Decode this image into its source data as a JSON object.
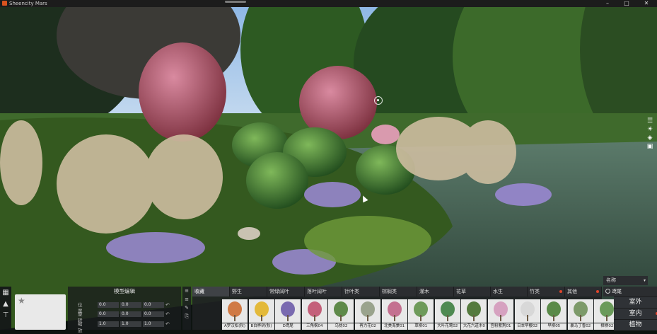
{
  "window": {
    "title": "Sheencity Mars",
    "minimize": "–",
    "maximize": "□",
    "close": "✕"
  },
  "right_toolbar": [
    {
      "icon": "list-icon",
      "glyph": "☰"
    },
    {
      "icon": "sun-icon",
      "glyph": "☀"
    },
    {
      "icon": "layers-icon",
      "glyph": "◈"
    },
    {
      "icon": "camera-icon",
      "glyph": "▣"
    }
  ],
  "left_tools": [
    {
      "icon": "object-icon",
      "glyph": "▦"
    },
    {
      "icon": "drop-icon",
      "glyph": "▲"
    },
    {
      "icon": "ruler-icon",
      "glyph": "⊤"
    }
  ],
  "model_panel": {
    "title": "模型编辑",
    "rows": [
      {
        "label": "位置",
        "values": [
          "0.0",
          "0.0",
          "0.0"
        ]
      },
      {
        "label": "旋转",
        "values": [
          "0.0",
          "0.0",
          "0.0"
        ]
      },
      {
        "label": "缩放",
        "values": [
          "1.0",
          "1.0",
          "1.0"
        ]
      }
    ],
    "reset_glyph": "↶"
  },
  "side_tools": [
    "≡",
    "≡",
    "✎",
    "⎘"
  ],
  "tabs": [
    {
      "label": "收藏",
      "active": true
    },
    {
      "label": "野生"
    },
    {
      "label": "常绿阔叶"
    },
    {
      "label": "落叶阔叶"
    },
    {
      "label": "针叶类"
    },
    {
      "label": "棕榈类"
    },
    {
      "label": "灌木"
    },
    {
      "label": "花草"
    },
    {
      "label": "水生"
    },
    {
      "label": "竹类",
      "dot": true
    },
    {
      "label": "其他",
      "dot": true
    }
  ],
  "thumbnails": [
    {
      "caption": "A罗汉松(秋)",
      "color": "#d07a45"
    },
    {
      "caption": "B白桦树(秋)",
      "color": "#e3b93a"
    },
    {
      "caption": "D鸢尾",
      "color": "#7a6ab0"
    },
    {
      "caption": "三角枫04",
      "color": "#c4607a"
    },
    {
      "caption": "乌枕02",
      "color": "#5f8a4a"
    },
    {
      "caption": "再力花02",
      "color": "#9aa38d"
    },
    {
      "caption": "北美海棠01",
      "color": "#c47090"
    },
    {
      "caption": "草柳01",
      "color": "#6e9a5a"
    },
    {
      "caption": "大叶花莺02",
      "color": "#4f8a52"
    },
    {
      "caption": "大花六道木0",
      "color": "#557a3e"
    },
    {
      "caption": "宫粉紫荆01",
      "color": "#d6a2c0"
    },
    {
      "caption": "日本早樱02",
      "color": "#d8d8d8"
    },
    {
      "caption": "早柳05",
      "color": "#5a8a48"
    },
    {
      "caption": "暴马丁香02",
      "color": "#7d9a6a"
    },
    {
      "caption": "樟栁02",
      "color": "#6a9a5a"
    }
  ],
  "sort": {
    "label": "名称",
    "caret": "▾"
  },
  "search": {
    "value": "鸢尾"
  },
  "categories": [
    {
      "label": "室外"
    },
    {
      "label": "室内",
      "dot": true
    },
    {
      "label": "植物"
    }
  ]
}
